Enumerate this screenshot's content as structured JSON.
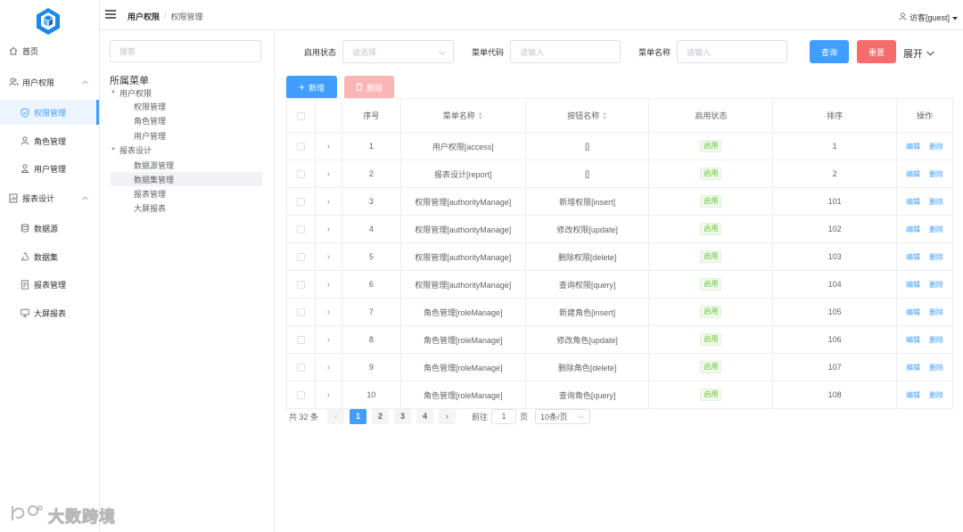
{
  "sidebar": {
    "items": [
      {
        "label": "首页",
        "icon": "home-icon"
      },
      {
        "label": "用户权限",
        "icon": "user-group-icon"
      },
      {
        "label": "权限管理",
        "icon": "shield-icon"
      },
      {
        "label": "角色管理",
        "icon": "person-icon"
      },
      {
        "label": "用户管理",
        "icon": "user-icon"
      },
      {
        "label": "报表设计",
        "icon": "report-icon"
      },
      {
        "label": "数据源",
        "icon": "database-icon"
      },
      {
        "label": "数据集",
        "icon": "recycle-icon"
      },
      {
        "label": "报表管理",
        "icon": "document-icon"
      },
      {
        "label": "大屏报表",
        "icon": "monitor-icon"
      }
    ]
  },
  "header": {
    "breadcrumb": [
      "用户权限",
      "权限管理"
    ],
    "breadcrumb_sep": "/",
    "user": "访客[guest]"
  },
  "tree": {
    "search_placeholder": "搜索",
    "root": "所属菜单",
    "nodes": [
      "用户权限",
      "权限管理",
      "角色管理",
      "用户管理",
      "报表设计",
      "数据源管理",
      "数据集管理",
      "报表管理",
      "大屏报表"
    ]
  },
  "filters": {
    "status_label": "启用状态",
    "status_placeholder": "请选择",
    "code_label": "菜单代码",
    "code_placeholder": "请输入",
    "name_label": "菜单名称",
    "name_placeholder": "请输入",
    "query": "查询",
    "reset": "重置",
    "expand": "展开"
  },
  "toolbar": {
    "add": "新增",
    "delete": "删除"
  },
  "table": {
    "headers": [
      "序号",
      "菜单名称",
      "按钮名称",
      "启用状态",
      "排序",
      "操作"
    ],
    "rows": [
      {
        "no": "1",
        "menu": "用户权限[access]",
        "button": "[]",
        "status": "启用",
        "sort": "1"
      },
      {
        "no": "2",
        "menu": "报表设计[report]",
        "button": "[]",
        "status": "启用",
        "sort": "2"
      },
      {
        "no": "3",
        "menu": "权限管理[authorityManage]",
        "button": "新增权限[insert]",
        "status": "启用",
        "sort": "101"
      },
      {
        "no": "4",
        "menu": "权限管理[authorityManage]",
        "button": "修改权限[update]",
        "status": "启用",
        "sort": "102"
      },
      {
        "no": "5",
        "menu": "权限管理[authorityManage]",
        "button": "删除权限[delete]",
        "status": "启用",
        "sort": "103"
      },
      {
        "no": "6",
        "menu": "权限管理[authorityManage]",
        "button": "查询权限[query]",
        "status": "启用",
        "sort": "104"
      },
      {
        "no": "7",
        "menu": "角色管理[roleManage]",
        "button": "新建角色[insert]",
        "status": "启用",
        "sort": "105"
      },
      {
        "no": "8",
        "menu": "角色管理[roleManage]",
        "button": "修改角色[update]",
        "status": "启用",
        "sort": "106"
      },
      {
        "no": "9",
        "menu": "角色管理[roleManage]",
        "button": "删除角色[delete]",
        "status": "启用",
        "sort": "107"
      },
      {
        "no": "10",
        "menu": "角色管理[roleManage]",
        "button": "查询角色[query]",
        "status": "启用",
        "sort": "108"
      }
    ],
    "edit": "编辑",
    "remove": "删除"
  },
  "pagination": {
    "total": "共 32 条",
    "pages": [
      "1",
      "2",
      "3",
      "4"
    ],
    "goto_prefix": "前往",
    "goto_value": "1",
    "goto_suffix": "页",
    "page_size": "10条/页"
  },
  "watermark": "大数跨境",
  "colors": {
    "primary": "#409eff",
    "danger": "#f56c6c",
    "success": "#67c23a"
  }
}
